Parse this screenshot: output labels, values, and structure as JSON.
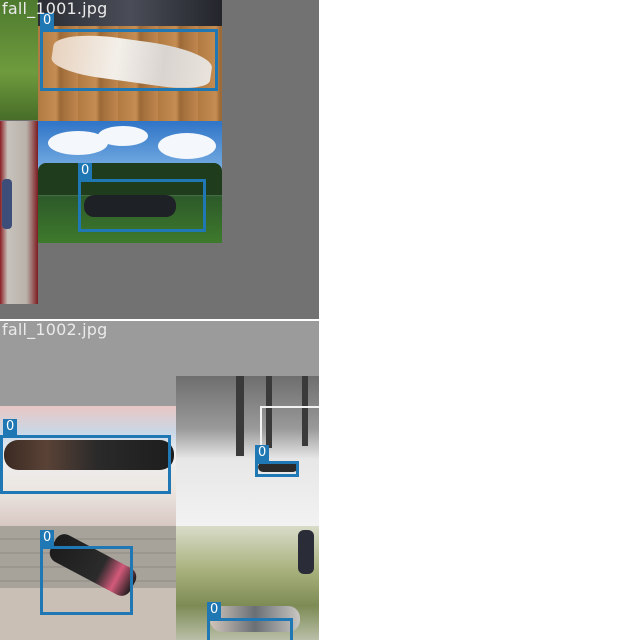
{
  "tiles": [
    {
      "label": "fall_1001.jpg",
      "detections": [
        {
          "class_label": "0"
        },
        {
          "class_label": "0"
        }
      ]
    },
    {
      "label": "fall_1002.jpg",
      "detections": [
        {
          "class_label": "0"
        },
        {
          "class_label": "0"
        },
        {
          "class_label": "0"
        },
        {
          "class_label": "0"
        }
      ]
    }
  ],
  "colors": {
    "bbox": "#1f77b4",
    "tile_background": "#727272",
    "page_background": "#ffffff"
  }
}
